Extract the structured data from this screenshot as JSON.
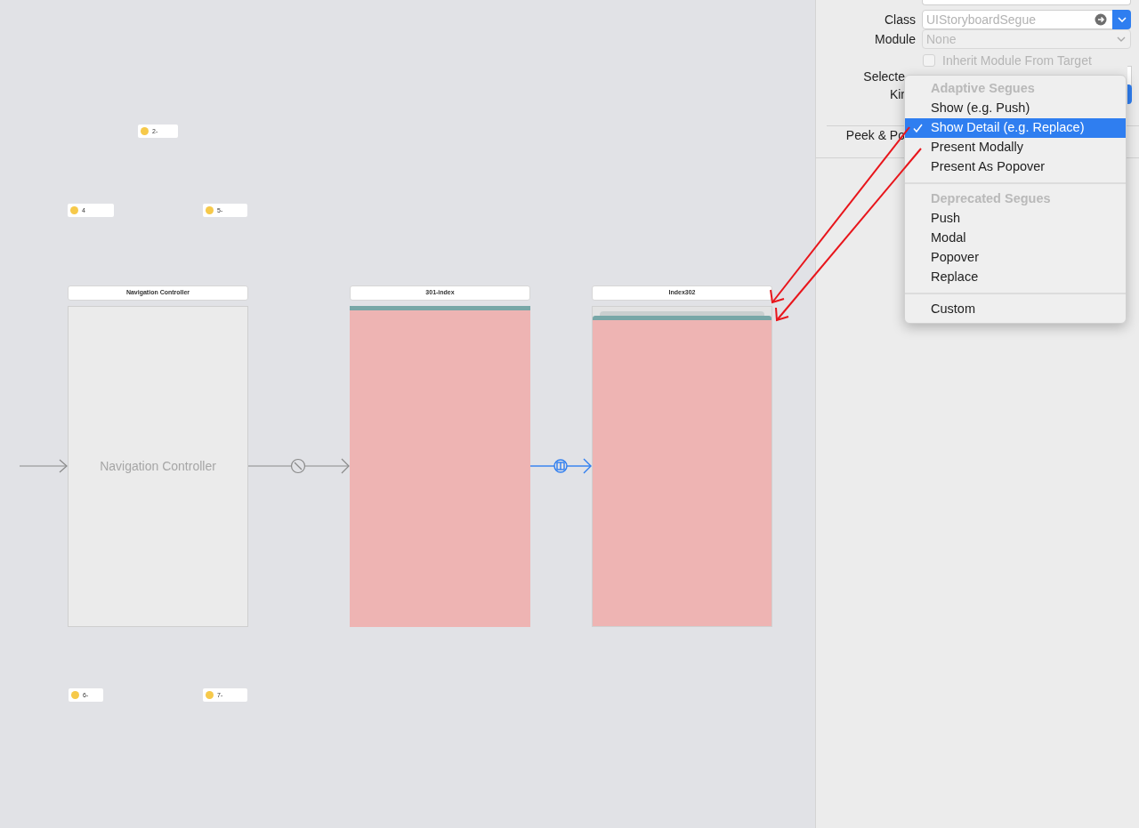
{
  "canvas": {
    "scenes": [
      {
        "kind": "navigation",
        "title": "Navigation Controller",
        "body_label": "Navigation Controller"
      },
      {
        "kind": "view",
        "title": "301-index"
      },
      {
        "kind": "detail_view",
        "title": "Index302"
      }
    ],
    "tags": [
      "2-",
      "4",
      "5-",
      "6-",
      "7-"
    ]
  },
  "inspector": {
    "class_field": {
      "label": "Class",
      "placeholder": "UIStoryboardSegue"
    },
    "module_field": {
      "label": "Module",
      "placeholder": "None",
      "disabled": true
    },
    "inherit_checkbox": {
      "label": "Inherit Module From Target",
      "checked": false,
      "disabled": true
    },
    "selector_label": "Selecte",
    "kind_label": "Kir",
    "peek_label": "Peek & Po"
  },
  "kind_menu": {
    "items": [
      {
        "kind": "header",
        "label": "Adaptive Segues"
      },
      {
        "kind": "option",
        "label": "Show (e.g. Push)",
        "selected": false
      },
      {
        "kind": "option",
        "label": "Show Detail (e.g. Replace)",
        "selected": true
      },
      {
        "kind": "option",
        "label": "Present Modally",
        "selected": false
      },
      {
        "kind": "option",
        "label": "Present As Popover",
        "selected": false
      },
      {
        "kind": "separator"
      },
      {
        "kind": "header",
        "label": "Deprecated Segues"
      },
      {
        "kind": "option",
        "label": "Push",
        "selected": false
      },
      {
        "kind": "option",
        "label": "Modal",
        "selected": false
      },
      {
        "kind": "option",
        "label": "Popover",
        "selected": false
      },
      {
        "kind": "option",
        "label": "Replace",
        "selected": false
      },
      {
        "kind": "separator"
      },
      {
        "kind": "option",
        "label": "Custom",
        "selected": false
      }
    ]
  }
}
